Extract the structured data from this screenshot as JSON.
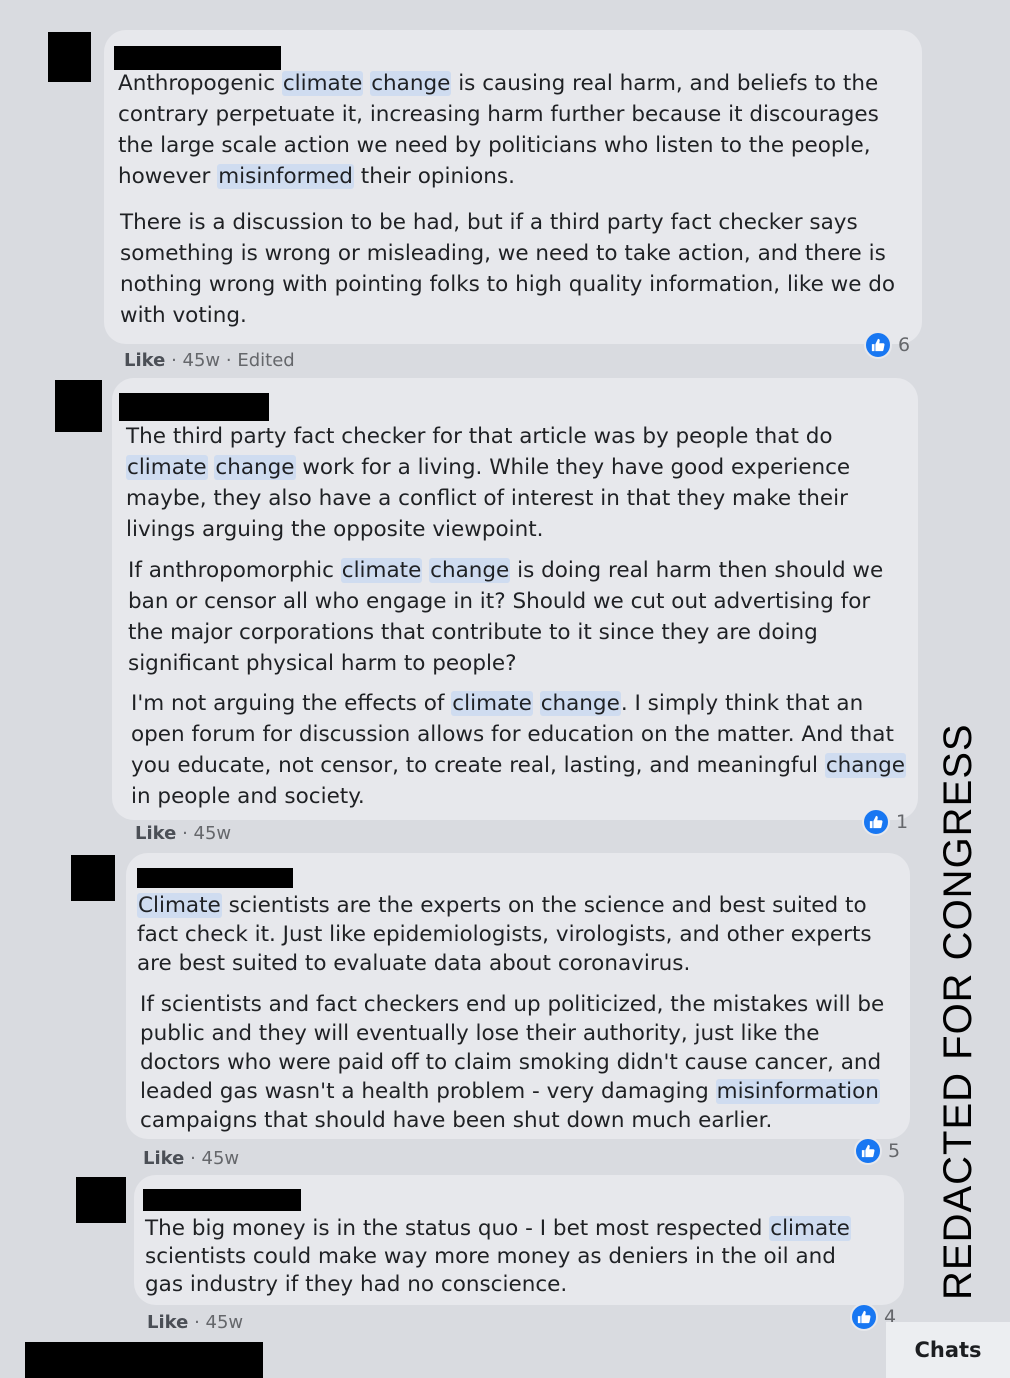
{
  "comments": [
    {
      "paragraphs": [
        [
          {
            "t": "Anthropogenic "
          },
          {
            "t": "climate",
            "hl": true
          },
          {
            "t": " "
          },
          {
            "t": "change",
            "hl": true
          },
          {
            "t": " is causing real harm, and beliefs to the contrary perpetuate it, increasing harm further because it discourages the large scale action we need by politicians who listen to the people, however "
          },
          {
            "t": "misinformed",
            "hl": true
          },
          {
            "t": " their opinions."
          }
        ],
        [
          {
            "t": "There is a discussion to be had, but if a third party fact checker says something is wrong or misleading, we need to take action, and there is nothing wrong with pointing folks to high quality information, like we do with voting."
          }
        ]
      ],
      "like": "Like",
      "time": "45w",
      "edited": "Edited",
      "reactions": "6"
    },
    {
      "paragraphs": [
        [
          {
            "t": "The third party fact checker for that article was by people that do "
          },
          {
            "t": "climate",
            "hl": true
          },
          {
            "t": " "
          },
          {
            "t": "change",
            "hl": true
          },
          {
            "t": " work for a living. While they have good experience maybe, they also have a conflict of interest in that they make their livings arguing the opposite viewpoint."
          }
        ],
        [
          {
            "t": "If anthropomorphic "
          },
          {
            "t": "climate",
            "hl": true
          },
          {
            "t": " "
          },
          {
            "t": "change",
            "hl": true
          },
          {
            "t": " is doing real harm then should we ban or censor all who engage in it? Should we cut out advertising for the major corporations that contribute to it since they are doing significant physical harm to people?"
          }
        ],
        [
          {
            "t": "I'm not arguing the effects of "
          },
          {
            "t": "climate",
            "hl": true
          },
          {
            "t": " "
          },
          {
            "t": "change",
            "hl": true
          },
          {
            "t": ". I simply think that an open forum for discussion allows for education on the matter. And that you educate, not censor, to create real, lasting, and meaningful "
          },
          {
            "t": "change",
            "hl": true
          },
          {
            "t": " in people and society."
          }
        ]
      ],
      "like": "Like",
      "time": "45w",
      "reactions": "1"
    },
    {
      "paragraphs": [
        [
          {
            "t": "Climate",
            "hl": true
          },
          {
            "t": " scientists are the experts on the science and best suited to fact check it. Just like epidemiologists, virologists, and other experts are best suited to evaluate data about coronavirus."
          }
        ],
        [
          {
            "t": "If scientists and fact checkers end up politicized, the mistakes will be public and they will eventually lose their authority, just like the doctors who were paid off to claim smoking didn't cause cancer, and leaded gas wasn't a health problem - very damaging "
          },
          {
            "t": "misinformation",
            "hl": true
          },
          {
            "t": " campaigns that should have been shut down much earlier."
          }
        ]
      ],
      "like": "Like",
      "time": "45w",
      "reactions": "5"
    },
    {
      "paragraphs": [
        [
          {
            "t": "The big money is in the status quo - I bet most respected "
          },
          {
            "t": "climate",
            "hl": true
          },
          {
            "t": " scientists could make way more money as deniers in the oil and gas industry if they had no conscience."
          }
        ]
      ],
      "like": "Like",
      "time": "45w",
      "reactions": "4"
    }
  ],
  "side_label": "REDACTED FOR CONGRESS",
  "chats_label": "Chats",
  "colors": {
    "highlight": "#cfdcf0",
    "like_blue": "#1877f2",
    "bubble": "#e7e8ec"
  }
}
